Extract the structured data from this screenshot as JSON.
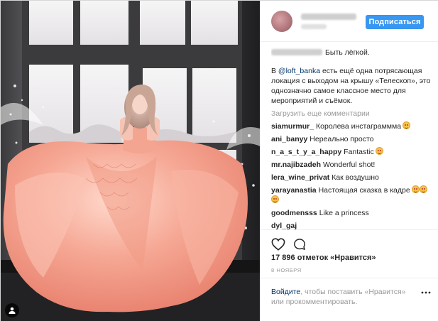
{
  "header": {
    "follow_label": "Подписаться"
  },
  "caption": {
    "text": "Быть лёгкой.",
    "paragraph_prefix": "В ",
    "mention": "@loft_banka",
    "paragraph_rest": " есть ещё одна потрясающая локация с выходом на крышу «Телескоп», это однозначно самое классное место для мероприятий и съёмок."
  },
  "load_more_label": "Загрузить еще комментарии",
  "comments": [
    {
      "user": "siamurmur_",
      "text": "Королева инстаграммма",
      "emoji_count": 1
    },
    {
      "user": "ani_banyy",
      "text": "Нереально просто",
      "emoji_count": 0
    },
    {
      "user": "n_a_s_t_y_a_happy",
      "text": "Fantastic",
      "emoji_count": 1
    },
    {
      "user": "mr.najibzadeh",
      "text": "Wonderful shot!",
      "emoji_count": 0
    },
    {
      "user": "lera_wine_privat",
      "text": "Как воздушно",
      "emoji_count": 0
    },
    {
      "user": "yarayanastia",
      "text": "Настоящая сказка в кадре",
      "emoji_count": 3
    },
    {
      "user": "goodmensss",
      "text": "Like a princess",
      "emoji_count": 0
    },
    {
      "user": "dyl_gaj",
      "text": "",
      "emoji_count": 0
    }
  ],
  "actions": {
    "like_icon": "heart-icon",
    "comment_icon": "comment-bubble-icon",
    "more_icon": "ellipsis-icon",
    "tag_icon": "person-tag-icon"
  },
  "likes_text": "17 896 отметок «Нравится»",
  "date_text": "8 НОЯБРЯ",
  "login": {
    "link": "Войдите",
    "rest": ", чтобы поставить «Нравится» или прокомментировать."
  },
  "colors": {
    "accent": "#3897f0",
    "link": "#003569",
    "muted": "#999999",
    "dress": "#f4a08e"
  }
}
